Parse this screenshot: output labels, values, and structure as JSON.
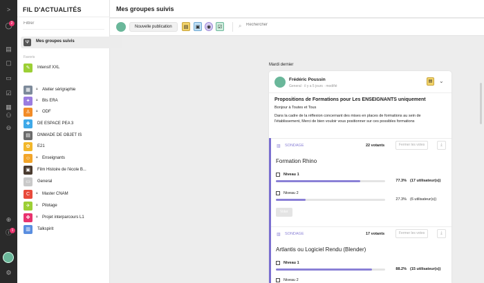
{
  "rail": {
    "expand_label": ">",
    "notifications_count": "2",
    "alert_count": "1"
  },
  "feed": {
    "title": "FIL D'ACTUALITÉS",
    "filter_placeholder": "Filtrer",
    "active_item": "Mes groupes suivis",
    "favorites_label": "Favoris",
    "groups": [
      {
        "name": "Intensif XXL",
        "locked": false,
        "color": "#9ccf35",
        "glyph": "✎"
      },
      {
        "name": "Atelier sérigraphie",
        "locked": true,
        "color": "#7d8a9a",
        "glyph": "▦"
      },
      {
        "name": "Bts ERA",
        "locked": true,
        "color": "#9b7de0",
        "glyph": "✦"
      },
      {
        "name": "ODF",
        "locked": true,
        "color": "#f28c28",
        "glyph": "♙"
      },
      {
        "name": "DE ESPACE PEA 3",
        "locked": false,
        "color": "#3fa9e8",
        "glyph": "✚"
      },
      {
        "name": "DNMADE DE OBJET IS",
        "locked": false,
        "color": "#6b6b6b",
        "glyph": "▤"
      },
      {
        "name": "E21",
        "locked": false,
        "color": "#f2b72a",
        "glyph": "✿"
      },
      {
        "name": "Enseignants",
        "locked": true,
        "color": "#f2a52a",
        "glyph": "☺"
      },
      {
        "name": "Film Histoire de l'école B...",
        "locked": false,
        "color": "#4a3b30",
        "glyph": "▣"
      },
      {
        "name": "General",
        "locked": false,
        "color": "#c9c9c9",
        "glyph": "▭"
      },
      {
        "name": "Master CNAM",
        "locked": true,
        "color": "#e84a3b",
        "glyph": "C"
      },
      {
        "name": "Pilotage",
        "locked": true,
        "color": "#9ccf35",
        "glyph": "✈"
      },
      {
        "name": "Projet interparcours L1",
        "locked": true,
        "color": "#e8336d",
        "glyph": "✤"
      },
      {
        "name": "Talkspirit",
        "locked": false,
        "color": "#5a8ee0",
        "glyph": "▥"
      }
    ]
  },
  "header": {
    "title": "Mes groupes suivis"
  },
  "toolbar": {
    "publish_label": "Nouvelle publication",
    "search_placeholder": "Rechercher"
  },
  "post": {
    "date_label": "Mardi dernier",
    "author": "Frédéric Poussin",
    "meta": "General · il y a 5 jours · modifié",
    "title": "Propositions de Formations pour Les ENSEIGNANTS uniquement",
    "greeting": "Bonjour à Toutes et Tous",
    "body": "Dans la cadre de la réflexion concernant des mises en places de formations au sein de l'établissement, Merci de bien vouloir vous positionner sur ces possibles formations"
  },
  "polls": [
    {
      "label": "SONDAGE",
      "votes": "22 votants",
      "close_label": "Fermer les votes",
      "question": "Formation Rhino",
      "vote_label": "Voter",
      "options": [
        {
          "label": "Niveau 1",
          "percent": "77.3%",
          "fraction": 0.773,
          "users": "(17 utilisateur(s))",
          "bold": true
        },
        {
          "label": "Niveau 2",
          "percent": "27.3%",
          "fraction": 0.273,
          "users": "(6 utilisateur(s))",
          "bold": false
        }
      ]
    },
    {
      "label": "SONDAGE",
      "votes": "17 votants",
      "close_label": "Fermer les votes",
      "question": "Artlantis ou Logiciel Rendu (Blender)",
      "options": [
        {
          "label": "Niveau 1",
          "percent": "88.2%",
          "fraction": 0.882,
          "users": "(15 utilisateur(s))",
          "bold": true
        },
        {
          "label": "Niveau 2",
          "percent": "",
          "fraction": 0,
          "users": "",
          "bold": false
        }
      ]
    }
  ]
}
